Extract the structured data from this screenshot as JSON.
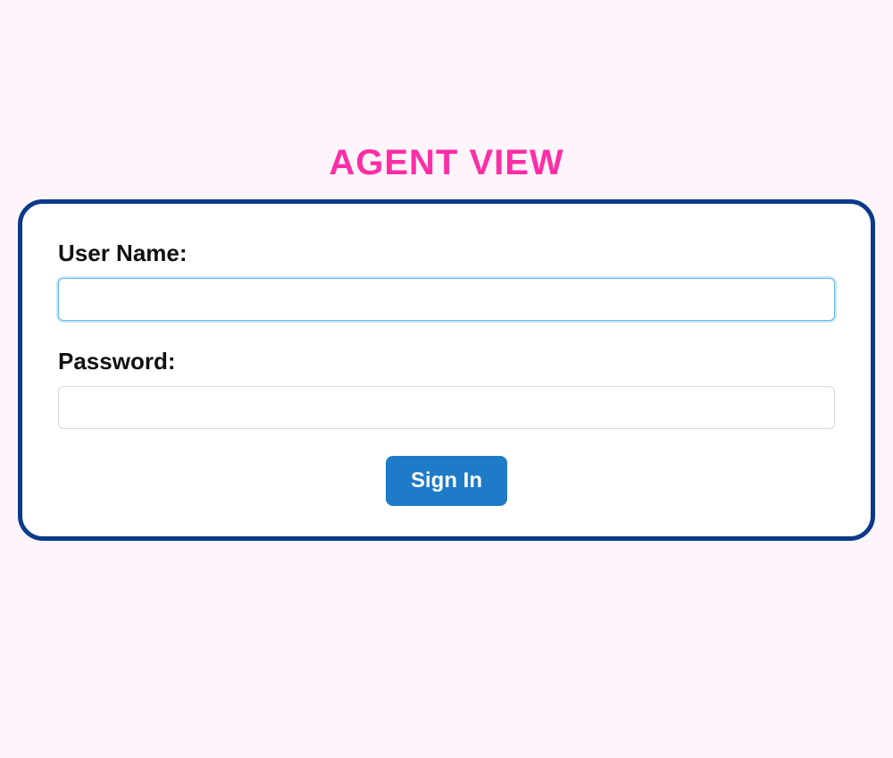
{
  "header": {
    "title": "AGENT VIEW"
  },
  "form": {
    "username": {
      "label": "User Name:",
      "value": ""
    },
    "password": {
      "label": "Password:",
      "value": ""
    },
    "submit": {
      "label": "Sign In"
    }
  }
}
